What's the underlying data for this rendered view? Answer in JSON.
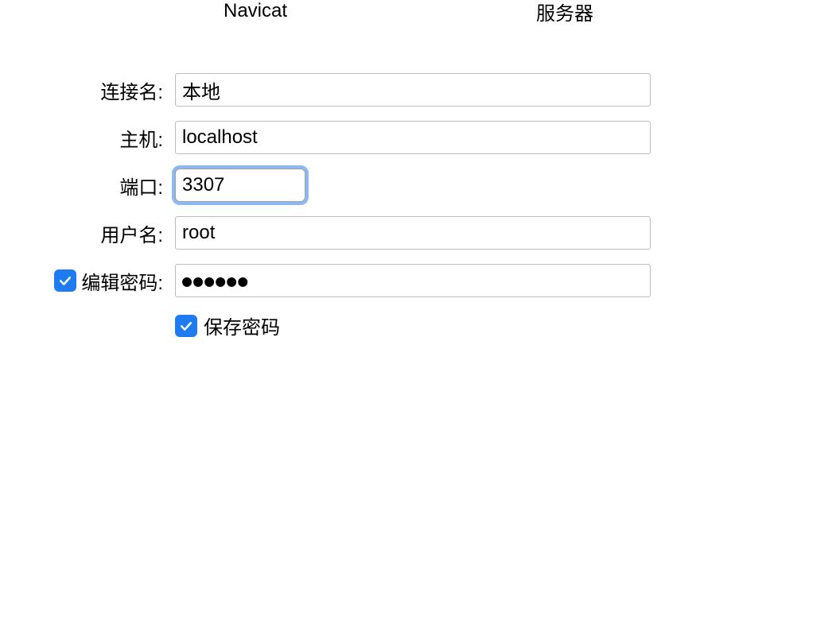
{
  "tabs": {
    "navicat": "Navicat",
    "server": "服务器"
  },
  "form": {
    "connection_name_label": "连接名:",
    "connection_name_value": "本地",
    "host_label": "主机:",
    "host_value": "localhost",
    "port_label": "端口:",
    "port_value": "3307",
    "username_label": "用户名:",
    "username_value": "root",
    "edit_password_label": "编辑密码:",
    "edit_password_checked": true,
    "password_value": "●●●●●●",
    "save_password_label": "保存密码",
    "save_password_checked": true
  }
}
